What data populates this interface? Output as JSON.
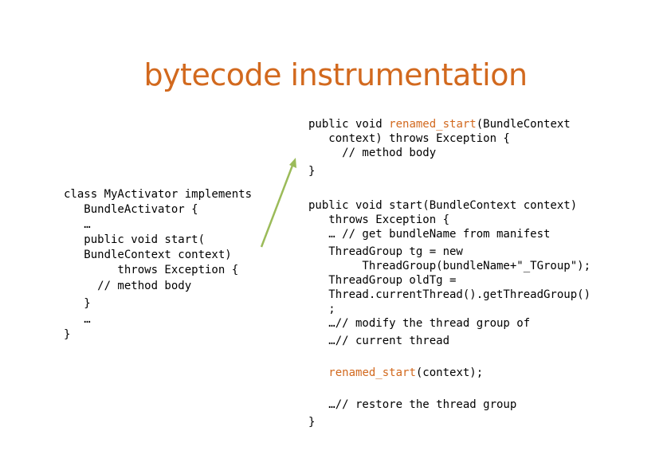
{
  "slide": {
    "title": "bytecode instrumentation"
  },
  "left_code": [
    "class MyActivator implements",
    "   BundleActivator {",
    "   …",
    "   public void start(",
    "   BundleContext context)",
    "        throws Exception {",
    "     // method body",
    "   }",
    "   …",
    "}"
  ],
  "right_code": {
    "renamed_method": {
      "prefix": "public void ",
      "name": "renamed_start",
      "suffix": "(BundleContext",
      "line2": "   context) throws Exception {",
      "line3": "     // method body",
      "line4": "}"
    },
    "start_method": {
      "line1": "public void start(BundleContext context)",
      "line2": "   throws Exception {",
      "line3": "   … // get bundleName from manifest",
      "line4": "   ThreadGroup tg = new",
      "line5": "        ThreadGroup(bundleName+\"_TGroup\");",
      "line6": "   ThreadGroup oldTg =",
      "line7": "   Thread.currentThread().getThreadGroup()",
      "line8": "   ;",
      "line9": "   …// modify the thread group of",
      "line10": "   …// current thread",
      "call_indent": "   ",
      "call_name": "renamed_start",
      "call_suffix": "(context);",
      "line12": "   …// restore the thread group",
      "line13": "}"
    }
  },
  "colors": {
    "title": "#d2691e",
    "highlight": "#d2691e",
    "arrow": "#9bbb59"
  }
}
